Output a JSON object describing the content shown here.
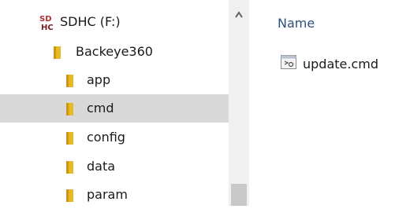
{
  "navigation_tree": {
    "drive": {
      "label": "SDHC (F:)",
      "icon": "sd-card-icon",
      "icon_text_top": "SD",
      "icon_text_bottom": "HC"
    },
    "root_folder": {
      "label": "Backeye360",
      "icon": "folder-icon"
    },
    "subfolders": [
      {
        "label": "app",
        "selected": false
      },
      {
        "label": "cmd",
        "selected": true
      },
      {
        "label": "config",
        "selected": false
      },
      {
        "label": "data",
        "selected": false
      },
      {
        "label": "param",
        "selected": false
      }
    ]
  },
  "scrollbar": {
    "up_icon": "chevron-up-icon"
  },
  "content": {
    "column_header": "Name",
    "files": [
      {
        "name": "update.cmd",
        "icon": "cmd-file-icon"
      }
    ]
  },
  "colors": {
    "selection": "#d9d9d9",
    "folder": "#e8b923",
    "header_text": "#2e4e7e",
    "scrollbar_track": "#f0f0f0"
  }
}
